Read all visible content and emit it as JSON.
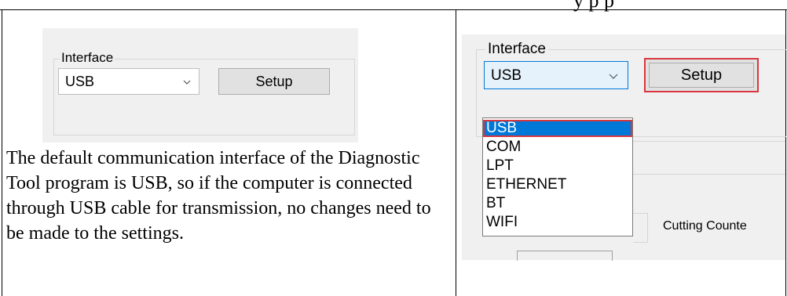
{
  "top_fragment": "y   p          p",
  "left_panel": {
    "group_label": "Interface",
    "combo_value": "USB",
    "setup_label": "Setup"
  },
  "description": "The default communication interface of the Diagnostic Tool program is USB, so if the computer is connected through USB cable for transmission, no changes need to be made to the settings.",
  "right_panel": {
    "group_label": "Interface",
    "combo_value": "USB",
    "setup_label": "Setup",
    "dropdown_options": [
      "USB",
      "COM",
      "LPT",
      "ETHERNET",
      "BT",
      "WIFI"
    ],
    "selected_option": "USB",
    "cutting_counter_label": "Cutting Counte"
  },
  "colors": {
    "highlight_red": "#d9363e",
    "selection_blue": "#0078d7",
    "window_bg": "#f0f0f0"
  }
}
